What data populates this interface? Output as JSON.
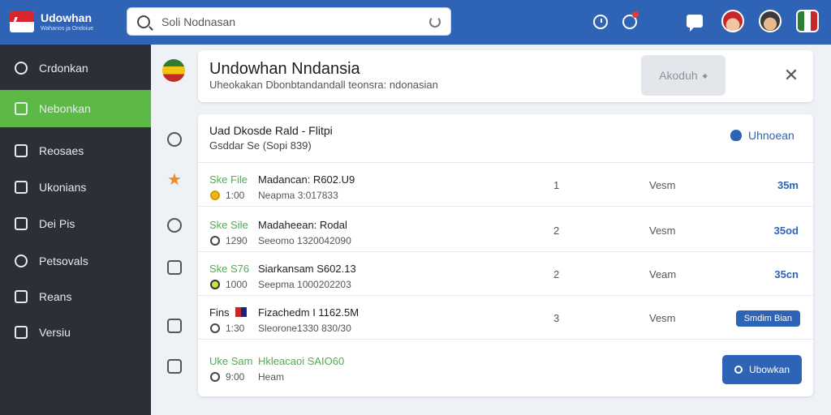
{
  "topbar": {
    "logo_title": "Udowhan",
    "logo_sub": "Wahanos ja Ondoiue",
    "search_placeholder": "Soli Nodnasan"
  },
  "sidebar": {
    "items": [
      {
        "label": "Crdonkan"
      },
      {
        "label": "Nebonkan"
      },
      {
        "label": "Reosaes"
      },
      {
        "label": "Ukonians"
      },
      {
        "label": "Dei Pis"
      },
      {
        "label": "Petsovals"
      },
      {
        "label": "Reans"
      },
      {
        "label": "Versiu"
      }
    ],
    "active_index": 1
  },
  "header": {
    "title": "Undowhan Nndansia",
    "subtitle": "Uheokakan Dbonbtandandall teonsra: ndonasian",
    "button_label": "Akoduh",
    "close_glyph": "✕"
  },
  "list": {
    "title": "Uad Dkosde Rald - Flitpi",
    "subtitle": "Gsddar Se (Sopi 839)",
    "action_label": "Uhnoean",
    "rows": [
      {
        "tag": "Ske File",
        "name": "Madancan: R602.U9",
        "small": "1:00",
        "meta": "Neapma 3:017833",
        "num": "1",
        "status": "Vesm",
        "time": "35m"
      },
      {
        "tag": "Ske Sile",
        "name": "Madaheean: Rodal",
        "small": "1290",
        "meta": "Seeomo 1320042090",
        "num": "2",
        "status": "Vesm",
        "time": "35od"
      },
      {
        "tag": "Ske S76",
        "name": "Siarkansam S602.13",
        "small": "1000",
        "meta": "Seepma 1000202203",
        "num": "2",
        "status": "Veam",
        "time": "35cn"
      },
      {
        "tag": "Fins",
        "name": "Fizachedm I 1162.5M",
        "small": "1:30",
        "meta": "Sleorone1330 830/30",
        "num": "3",
        "status": "Vesm",
        "pill": "Smdim Bian"
      },
      {
        "tag": "Uke Sam",
        "name": "Hkleacaoi SAIO60",
        "small": "9:00",
        "meta": "Heam",
        "button": "Ubowkan"
      }
    ]
  },
  "colors": {
    "topbar": "#2f63b5",
    "sidebar": "#2a2f38",
    "sidebar_active": "#5cb946",
    "accent": "#2f63b5",
    "tag_green": "#4caf50"
  }
}
